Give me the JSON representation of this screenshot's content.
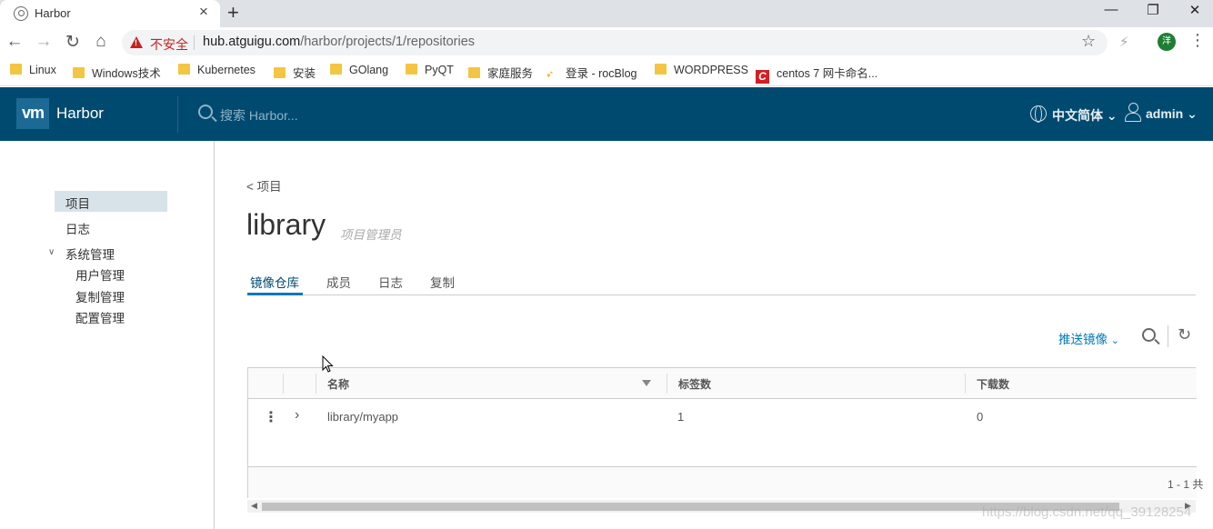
{
  "browser": {
    "tab_title": "Harbor",
    "tab_close": "×",
    "new_tab": "+",
    "window_controls": [
      "—",
      "❐",
      "✕"
    ],
    "security_label": "不安全",
    "url_host": "hub.atguigu.com",
    "url_path": "/harbor/projects/1/repositories",
    "profile_initial": "洋",
    "bookmarks": [
      {
        "label": "Linux",
        "icon": "folder-icon"
      },
      {
        "label": "Windows技术",
        "icon": "folder-icon"
      },
      {
        "label": "Kubernetes",
        "icon": "folder-icon"
      },
      {
        "label": "安装",
        "icon": "folder-icon"
      },
      {
        "label": "GOlang",
        "icon": "folder-icon"
      },
      {
        "label": "PyQT",
        "icon": "folder-icon"
      },
      {
        "label": "家庭服务",
        "icon": "folder-icon"
      },
      {
        "label": "登录 - rocBlog",
        "icon": "leaf-icon"
      },
      {
        "label": "WORDPRESS",
        "icon": "folder-icon"
      },
      {
        "label": "centos 7 网卡命名...",
        "icon": "c-logo-icon"
      }
    ]
  },
  "header": {
    "logo_text": "vm",
    "brand": "Harbor",
    "search_placeholder": "搜索 Harbor...",
    "language": "中文简体",
    "user": "admin",
    "colors": {
      "bar": "#004a70"
    }
  },
  "sidebar": {
    "items": [
      {
        "label": "项目",
        "active": true
      },
      {
        "label": "日志"
      },
      {
        "label": "系统管理"
      },
      {
        "label": "用户管理"
      },
      {
        "label": "复制管理"
      },
      {
        "label": "配置管理"
      }
    ]
  },
  "main": {
    "back_link": "< 项目",
    "project_name": "library",
    "project_role": "项目管理员",
    "tabs": [
      "镜像仓库",
      "成员",
      "日志",
      "复制"
    ],
    "active_tab": "镜像仓库",
    "push_image": "推送镜像",
    "table": {
      "columns": [
        "名称",
        "标签数",
        "下载数"
      ],
      "rows": [
        {
          "name": "library/myapp",
          "tags": "1",
          "pulls": "0"
        }
      ],
      "footer": "1 - 1 共"
    }
  },
  "watermark": "https://blog.csdn.net/qq_39128254"
}
